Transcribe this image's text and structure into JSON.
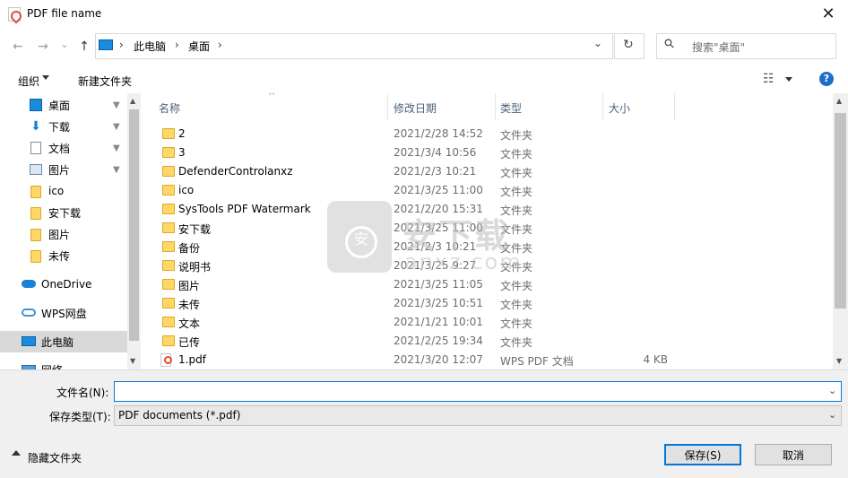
{
  "window": {
    "title": "PDF file name",
    "close_glyph": "✕"
  },
  "address": {
    "back_glyph": "←",
    "forward_glyph": "→",
    "recent_glyph": "⌄",
    "up_glyph": "↑",
    "crumbs": [
      "此电脑",
      "桌面"
    ],
    "separator": "›",
    "dropdown_glyph": "⌄",
    "refresh_glyph": "↻",
    "search_placeholder": "搜索\"桌面\"",
    "search_glyph": "⚲"
  },
  "toolbar": {
    "organize_label": "组织",
    "new_folder_label": "新建文件夹",
    "view_glyph": "☷",
    "help_glyph": "?"
  },
  "sidebar": {
    "items": [
      {
        "label": "桌面",
        "icon": "desktop-icon",
        "pinned": true
      },
      {
        "label": "下载",
        "icon": "download-icon",
        "pinned": true
      },
      {
        "label": "文档",
        "icon": "document-icon",
        "pinned": true
      },
      {
        "label": "图片",
        "icon": "picture-icon",
        "pinned": true
      },
      {
        "label": "ico",
        "icon": "folder-icon",
        "pinned": false
      },
      {
        "label": "安下载",
        "icon": "folder-icon",
        "pinned": false
      },
      {
        "label": "图片",
        "icon": "folder-icon",
        "pinned": false
      },
      {
        "label": "未传",
        "icon": "folder-icon",
        "pinned": false
      },
      {
        "label": "OneDrive",
        "icon": "cloud-icon",
        "pinned": false
      },
      {
        "label": "WPS网盘",
        "icon": "cloud-icon",
        "pinned": false
      },
      {
        "label": "此电脑",
        "icon": "computer-icon",
        "pinned": false,
        "selected": true
      },
      {
        "label": "网络",
        "icon": "network-icon",
        "pinned": false
      }
    ],
    "pin_glyph": "📌"
  },
  "filelist": {
    "sort_glyph": "^",
    "columns": [
      "名称",
      "修改日期",
      "类型",
      "大小"
    ],
    "rows": [
      {
        "name": "2",
        "date": "2021/2/28 14:52",
        "type": "文件夹",
        "size": "",
        "icon": "folder-icon"
      },
      {
        "name": "3",
        "date": "2021/3/4 10:56",
        "type": "文件夹",
        "size": "",
        "icon": "folder-icon"
      },
      {
        "name": "DefenderControlanxz",
        "date": "2021/2/3 10:21",
        "type": "文件夹",
        "size": "",
        "icon": "folder-icon"
      },
      {
        "name": "ico",
        "date": "2021/3/25 11:00",
        "type": "文件夹",
        "size": "",
        "icon": "folder-icon"
      },
      {
        "name": "SysTools PDF Watermark",
        "date": "2021/2/20 15:31",
        "type": "文件夹",
        "size": "",
        "icon": "folder-icon"
      },
      {
        "name": "安下载",
        "date": "2021/3/25 11:00",
        "type": "文件夹",
        "size": "",
        "icon": "folder-icon"
      },
      {
        "name": "备份",
        "date": "2021/2/3 10:21",
        "type": "文件夹",
        "size": "",
        "icon": "folder-icon"
      },
      {
        "name": "说明书",
        "date": "2021/3/25 9:27",
        "type": "文件夹",
        "size": "",
        "icon": "folder-icon"
      },
      {
        "name": "图片",
        "date": "2021/3/25 11:05",
        "type": "文件夹",
        "size": "",
        "icon": "folder-icon"
      },
      {
        "name": "未传",
        "date": "2021/3/25 10:51",
        "type": "文件夹",
        "size": "",
        "icon": "folder-icon"
      },
      {
        "name": "文本",
        "date": "2021/1/21 10:01",
        "type": "文件夹",
        "size": "",
        "icon": "folder-icon"
      },
      {
        "name": "已传",
        "date": "2021/2/25 19:34",
        "type": "文件夹",
        "size": "",
        "icon": "folder-icon"
      },
      {
        "name": "1.pdf",
        "date": "2021/3/20 12:07",
        "type": "WPS PDF 文档",
        "size": "4 KB",
        "icon": "pdf-file-icon"
      }
    ]
  },
  "watermark": {
    "text": "安下载",
    "sub": "anxz.com"
  },
  "form": {
    "filename_label": "文件名(N):",
    "filename_value": "",
    "filetype_label": "保存类型(T):",
    "filetype_value": "PDF documents (*.pdf)",
    "hide_folders_label": "隐藏文件夹",
    "save_label": "保存(S)",
    "cancel_label": "取消"
  },
  "colors": {
    "accent": "#0078d7",
    "folder": "#ffd766",
    "selected_bg": "#cce8ff"
  }
}
